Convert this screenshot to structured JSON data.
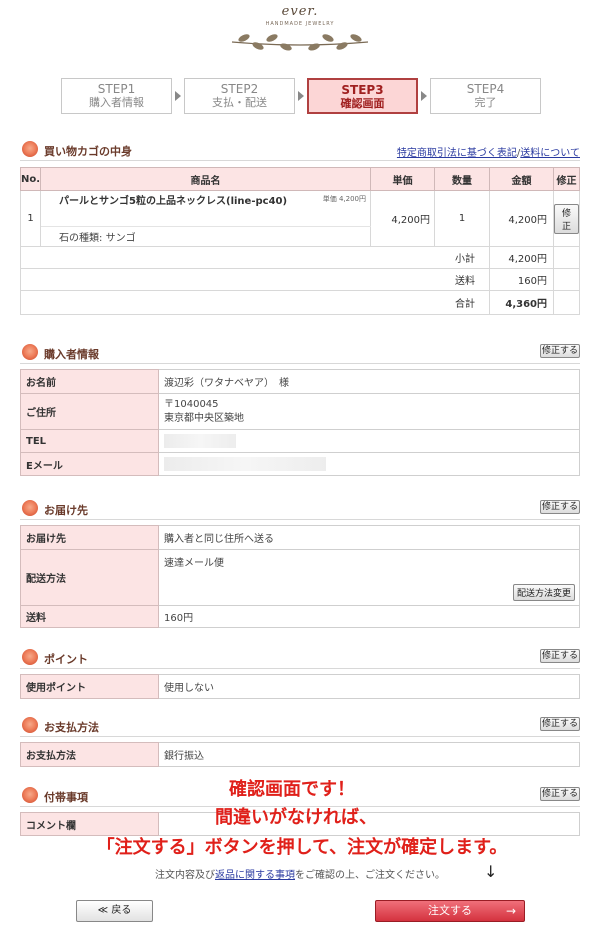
{
  "logo": {
    "text": "ever.",
    "sub": "HANDMADE JEWELRY"
  },
  "steps": [
    {
      "title": "STEP1",
      "sub": "購入者情報"
    },
    {
      "title": "STEP2",
      "sub": "支払・配送"
    },
    {
      "title": "STEP3",
      "sub": "確認画面"
    },
    {
      "title": "STEP4",
      "sub": "完了"
    }
  ],
  "cart": {
    "title": "買い物カゴの中身",
    "links": {
      "law": "特定商取引法に基づく表記",
      "sep": "/",
      "shipping": "送料について"
    },
    "headers": {
      "no": "No.",
      "name": "商品名",
      "price": "単価",
      "qty": "数量",
      "amount": "金額",
      "edit": "修正"
    },
    "item": {
      "no": "1",
      "name": "パールとサンゴ5粒の上品ネックレス(line-pc40)",
      "unit_label": "単価 4,200円",
      "option": "石の種類: サンゴ",
      "price": "4,200円",
      "qty": "1",
      "amount": "4,200円",
      "edit_label": "修正"
    },
    "subtotal": {
      "label": "小計",
      "value": "4,200円"
    },
    "shipping": {
      "label": "送料",
      "value": "160円"
    },
    "total": {
      "label": "合計",
      "value": "4,360円"
    }
  },
  "edit_label": "修正する",
  "buyer": {
    "title": "購入者情報",
    "name_label": "お名前",
    "name_value": "渡辺彩（ワタナベヤア）　様",
    "address_label": "ご住所",
    "postal": "〒1040045",
    "address": "東京都中央区築地",
    "tel_label": "TEL",
    "email_label": "Eメール"
  },
  "delivery": {
    "title": "お届け先",
    "dest_label": "お届け先",
    "dest_value": "購入者と同じ住所へ送る",
    "method_label": "配送方法",
    "method_value": "速達メール便",
    "method_change": "配送方法変更",
    "fee_label": "送料",
    "fee_value": "160円"
  },
  "points": {
    "title": "ポイント",
    "label": "使用ポイント",
    "value": "使用しない"
  },
  "payment": {
    "title": "お支払方法",
    "label": "お支払方法",
    "value": "銀行振込"
  },
  "notes": {
    "title": "付帯事項",
    "comment_label": "コメント欄"
  },
  "annotation": {
    "line1": "確認画面です！",
    "line2": "間違いがなければ、",
    "line3": "「注文する」ボタンを押して、注文が確定します。",
    "arrow": "↓"
  },
  "confirm": {
    "before": "注文内容及び",
    "link": "返品に関する事項",
    "after": "をご確認の上、ご注文ください。"
  },
  "buttons": {
    "back": "≪ 戻る",
    "order": "注文する",
    "order_arrow": "→"
  },
  "colors": {
    "accent": "#d4323e",
    "header_bg": "#fce4e4",
    "annotation": "#e0201a",
    "link": "#2a3aa0"
  }
}
